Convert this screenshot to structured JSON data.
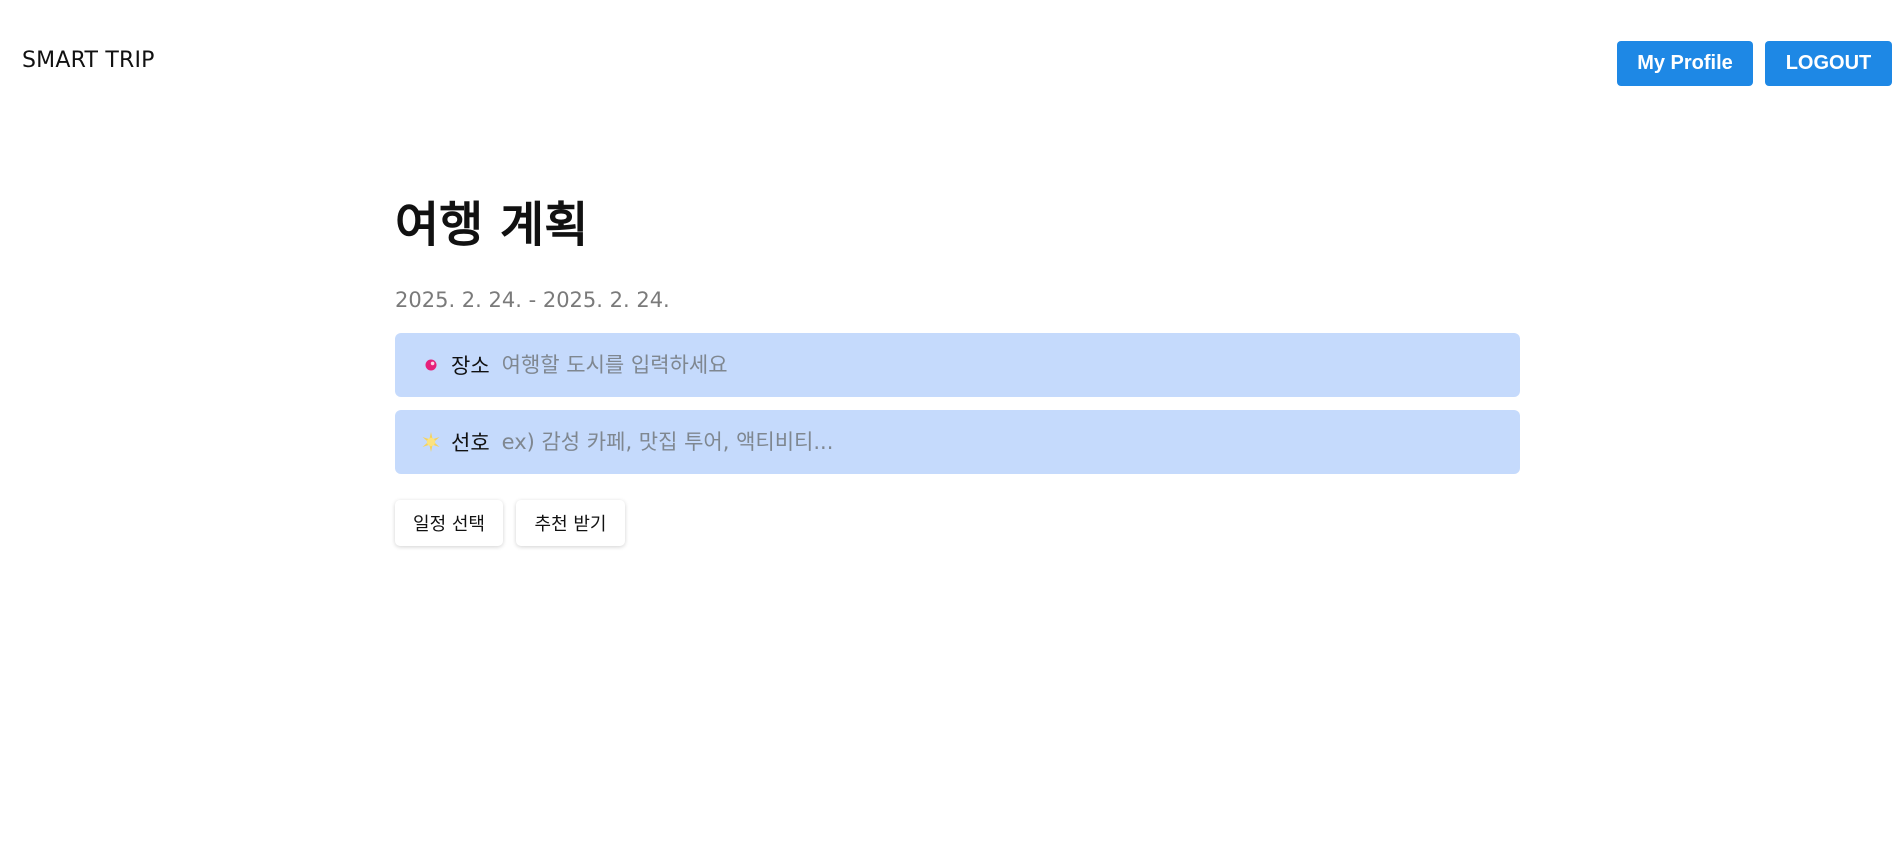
{
  "header": {
    "brand": "SMART TRIP",
    "profile_label": "My Profile",
    "logout_label": "LOGOUT",
    "accent_color": "#1e88e5"
  },
  "main": {
    "title": "여행 계획",
    "date_range": "2025. 2. 24. - 2025. 2. 24.",
    "fields": [
      {
        "icon": "pin-icon",
        "label": "장소",
        "placeholder": "여행할 도시를 입력하세요",
        "value": ""
      },
      {
        "icon": "sparkle-icon",
        "label": "선호",
        "placeholder": "ex) 감성 카페, 맛집 투어, 액티비티...",
        "value": ""
      }
    ],
    "field_bg_color": "#c5dafc",
    "buttons": {
      "schedule_label": "일정 선택",
      "recommend_label": "추천 받기"
    }
  }
}
